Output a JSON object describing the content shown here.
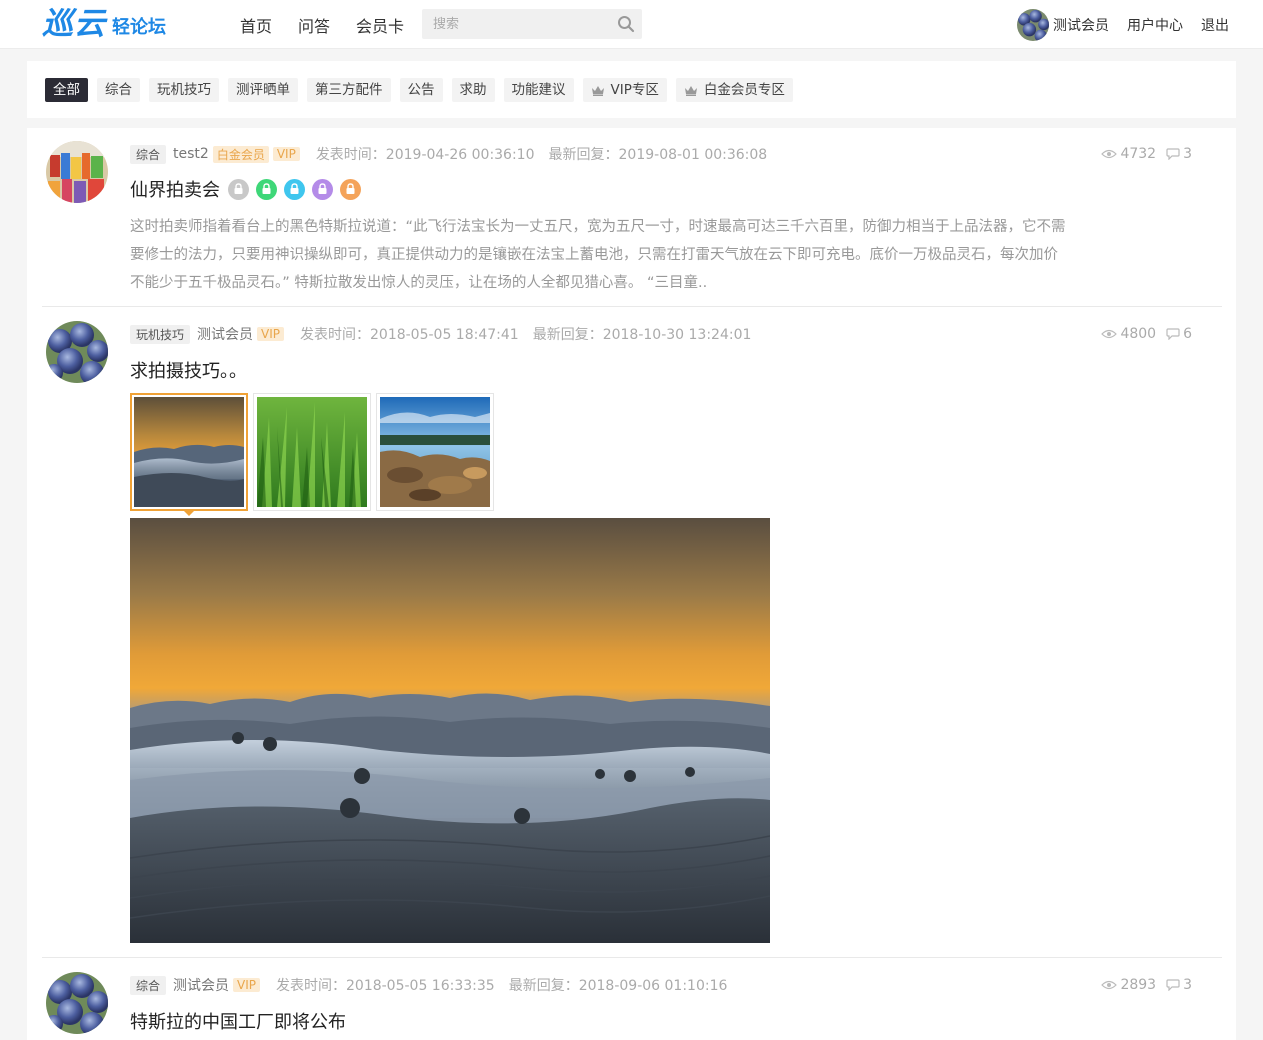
{
  "header": {
    "logo_main": "巡云",
    "logo_sub": "轻论坛",
    "nav": [
      "首页",
      "问答",
      "会员卡"
    ],
    "search_placeholder": "搜索",
    "user_name": "测试会员",
    "user_center": "用户中心",
    "logout": "退出"
  },
  "categories": [
    {
      "label": "全部",
      "active": true
    },
    {
      "label": "综合"
    },
    {
      "label": "玩机技巧"
    },
    {
      "label": "测评晒单"
    },
    {
      "label": "第三方配件"
    },
    {
      "label": "公告"
    },
    {
      "label": "求助"
    },
    {
      "label": "功能建议"
    },
    {
      "label": "VIP专区",
      "icon": "crown-icon"
    },
    {
      "label": "白金会员专区",
      "icon": "crown-icon"
    }
  ],
  "posts": [
    {
      "tag": "综合",
      "author": "test2",
      "badge_platinum": "白金会员",
      "badge_vip": "VIP",
      "published": "发表时间：2019-04-26 00:36:10",
      "last_reply": "最新回复：2019-08-01 00:36:08",
      "views": "4732",
      "comments": "3",
      "title": "仙界拍卖会",
      "locks": [
        "#c8c8c8",
        "#3ed778",
        "#3fc6ee",
        "#b48be8",
        "#f4a35a"
      ],
      "excerpt": "这时拍卖师指着看台上的黑色特斯拉说道：“此飞行法宝长为一丈五尺，宽为五尺一寸，时速最高可达三千六百里，防御力相当于上品法器，它不需要修士的法力，只要用神识操纵即可，真正提供动力的是镶嵌在法宝上蓄电池，只需在打雷天气放在云下即可充电。底价一万极品灵石，每次加价不能少于五千极品灵石。” 特斯拉散发出惊人的灵压，让在场的人全都见猎心喜。 “三目童.."
    },
    {
      "tag": "玩机技巧",
      "author": "测试会员",
      "badge_vip": "VIP",
      "published": "发表时间：2018-05-05 18:47:41",
      "last_reply": "最新回复：2018-10-30 13:24:01",
      "views": "4800",
      "comments": "6",
      "title": "求拍摄技巧。。",
      "images": [
        "foggy-sunset-hills",
        "green-grass",
        "rocky-coast"
      ]
    },
    {
      "tag": "综合",
      "author": "测试会员",
      "badge_vip": "VIP",
      "published": "发表时间：2018-05-05 16:33:35",
      "last_reply": "最新回复：2018-09-06 01:10:16",
      "views": "2893",
      "comments": "3",
      "title": "特斯拉的中国工厂即将公布"
    }
  ]
}
